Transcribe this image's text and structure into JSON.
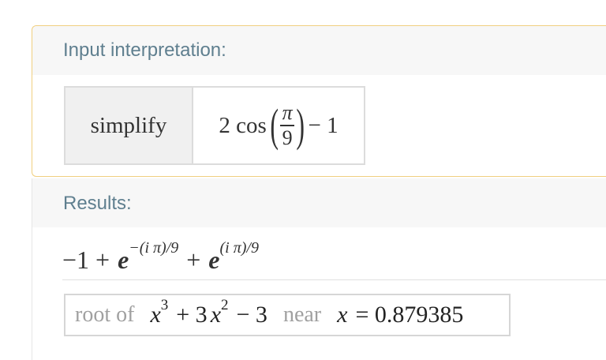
{
  "input_pod": {
    "title": "Input interpretation:",
    "keyword": "simplify",
    "expr_prefix": "2 cos",
    "frac_num": "π",
    "frac_den": "9",
    "expr_suffix": "− 1"
  },
  "results_pod": {
    "title": "Results:",
    "line1_prefix": "−1 +",
    "line1_e1": "e",
    "line1_exp1": "−(i π)/9",
    "line1_plus": "+",
    "line1_e2": "e",
    "line1_exp2": "(i π)/9",
    "root_of_label": "root of",
    "root_var1": "x",
    "root_pow1": "3",
    "root_mid": "+ 3",
    "root_var2": "x",
    "root_pow2": "2",
    "root_tail": "− 3",
    "near_label": "near",
    "near_var": "x",
    "near_value": "= 0.879385"
  },
  "colors": {
    "pod_title": "#5f7f8f",
    "input_border": "#f0cf80",
    "header_bg": "#f7f7f7"
  }
}
